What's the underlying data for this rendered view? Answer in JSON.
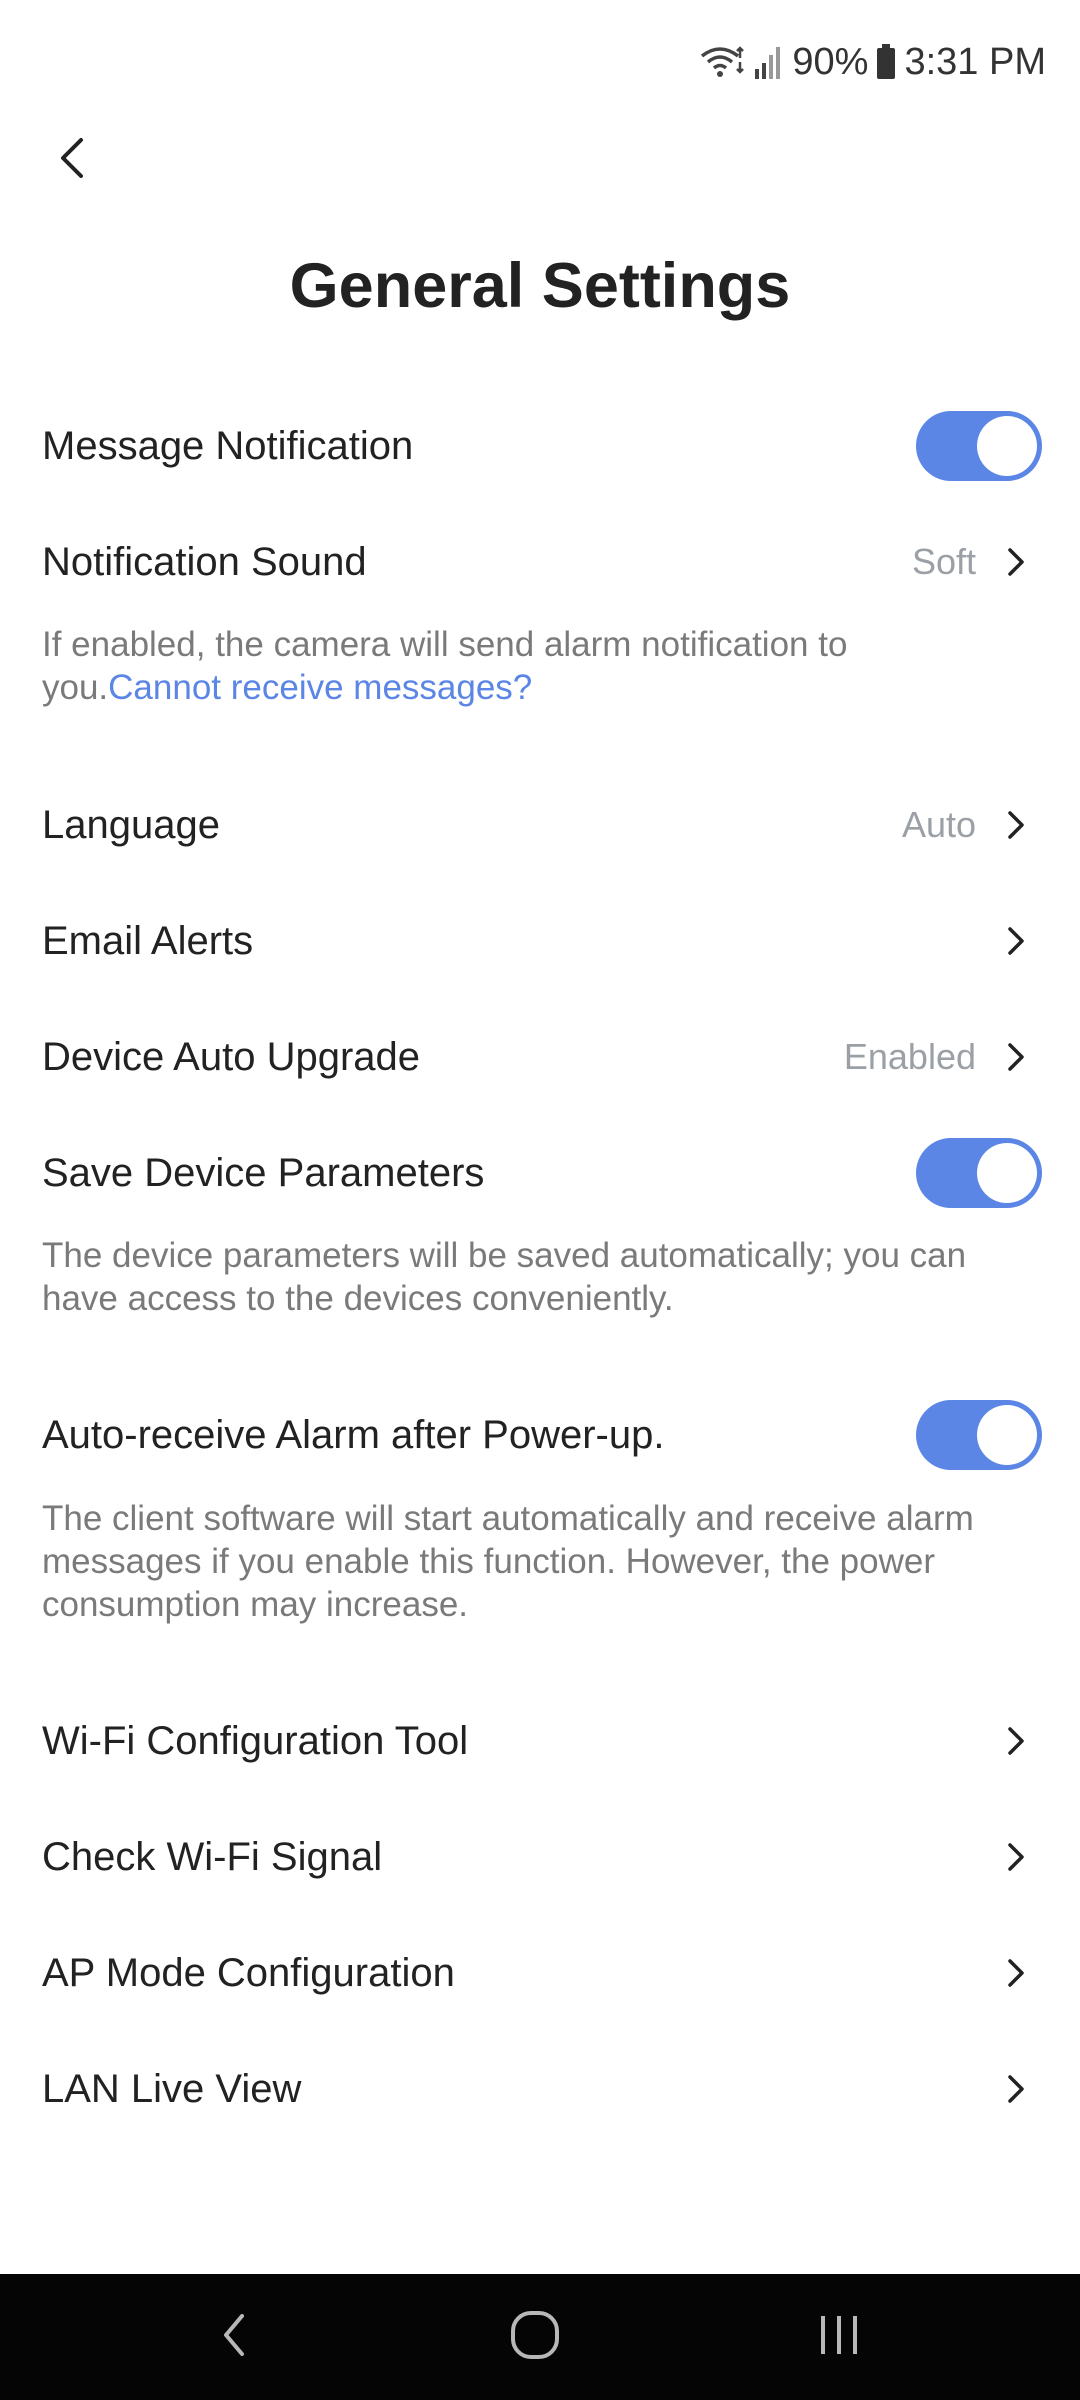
{
  "status_bar": {
    "battery": "90%",
    "time": "3:31 PM",
    "icons": [
      "wifi-icon",
      "signal-icon",
      "battery-icon"
    ]
  },
  "header": {
    "back_icon": "chevron-left-icon",
    "title": "General Settings"
  },
  "settings": {
    "message_notification": {
      "label": "Message Notification",
      "enabled": true
    },
    "notification_sound": {
      "label": "Notification Sound",
      "value": "Soft"
    },
    "notification_desc": {
      "text": "If enabled, the camera will send alarm notification to you.",
      "link": "Cannot receive messages?"
    },
    "language": {
      "label": "Language",
      "value": "Auto"
    },
    "email_alerts": {
      "label": "Email Alerts"
    },
    "device_auto_upgrade": {
      "label": "Device Auto Upgrade",
      "value": "Enabled"
    },
    "save_device_parameters": {
      "label": "Save Device Parameters",
      "enabled": true
    },
    "save_params_desc": "The device parameters will be saved automatically; you can have access to the devices conveniently.",
    "auto_receive_alarm": {
      "label": "Auto-receive Alarm after Power-up.",
      "enabled": true
    },
    "auto_receive_desc": "The client software will start automatically and receive alarm messages if you enable this function. However, the power consumption may increase.",
    "wifi_config_tool": {
      "label": "Wi-Fi Configuration Tool"
    },
    "check_wifi_signal": {
      "label": "Check Wi-Fi Signal"
    },
    "ap_mode_config": {
      "label": "AP Mode Configuration"
    },
    "lan_live_view": {
      "label": "LAN Live View"
    }
  },
  "nav_bar": {
    "icons": [
      "nav-back-icon",
      "nav-home-icon",
      "nav-recents-icon"
    ]
  },
  "colors": {
    "accent": "#5b86e5",
    "text": "#222222",
    "secondary_text": "#7a7a7a",
    "value_text": "#9aa0a6",
    "nav_bar": "#050505"
  }
}
